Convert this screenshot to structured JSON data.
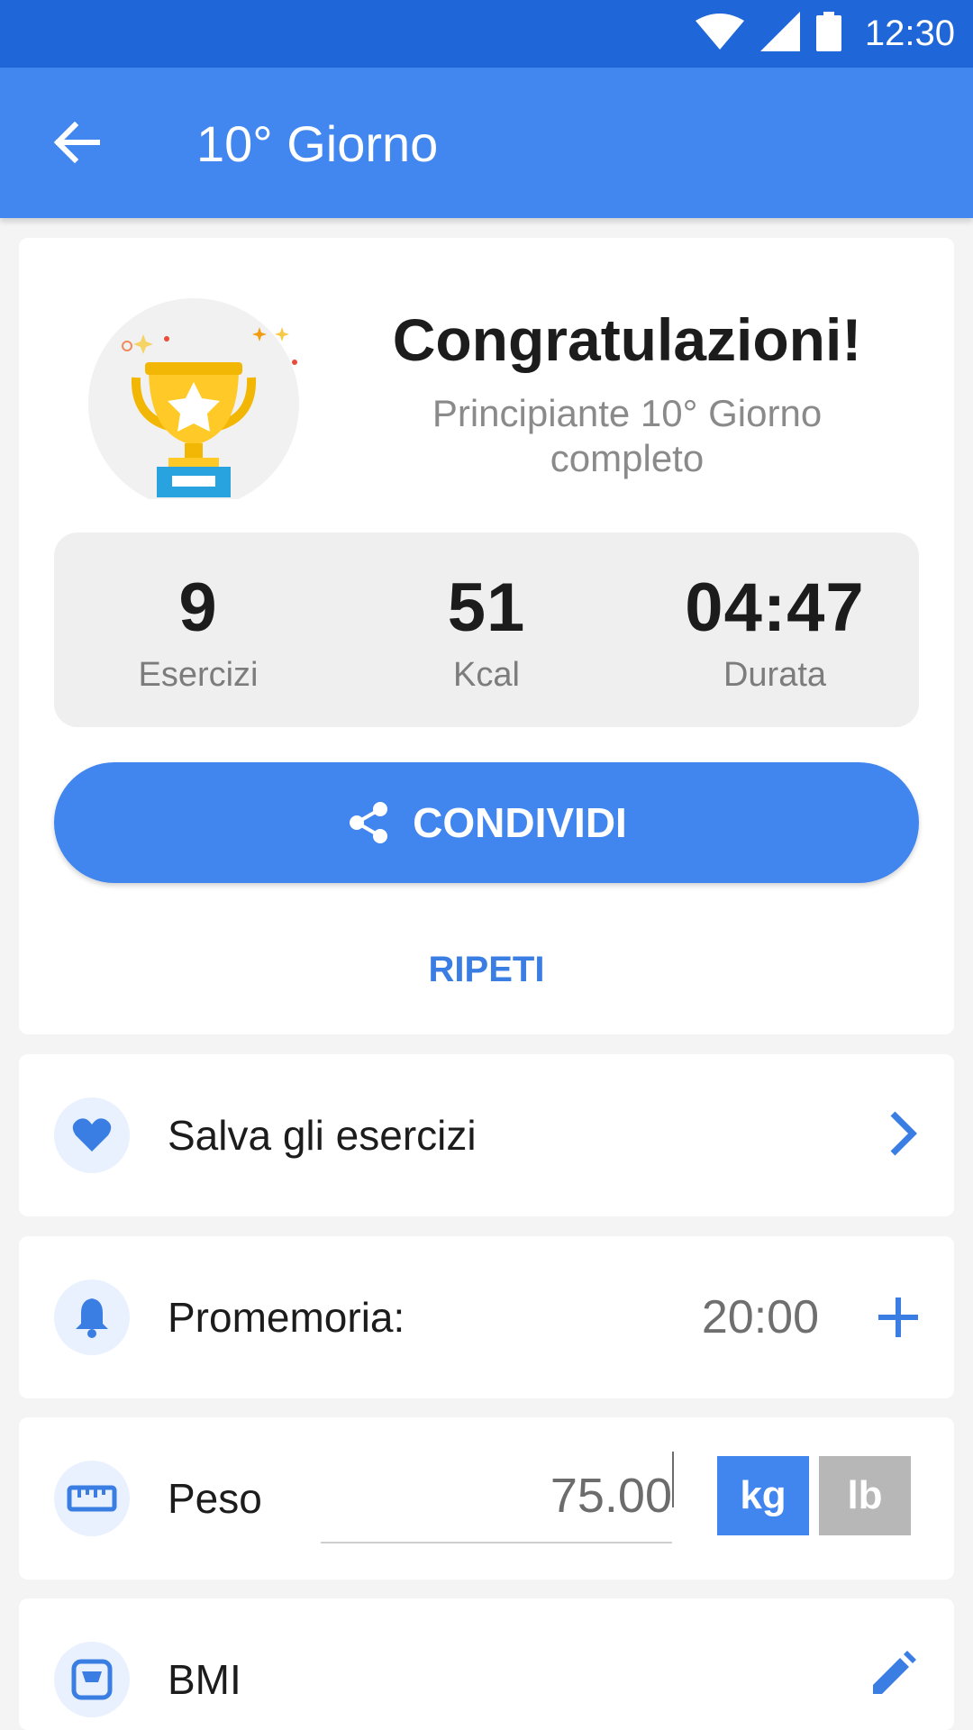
{
  "status_bar": {
    "time": "12:30"
  },
  "app_bar": {
    "title": "10° Giorno"
  },
  "result": {
    "heading": "Congratulazioni!",
    "subtitle": "Principiante 10° Giorno completo"
  },
  "stats": [
    {
      "value": "9",
      "label": "Esercizi"
    },
    {
      "value": "51",
      "label": "Kcal"
    },
    {
      "value": "04:47",
      "label": "Durata"
    }
  ],
  "share_label": "CONDIVIDI",
  "repeat_label": "RIPETI",
  "save": {
    "label": "Salva gli esercizi"
  },
  "reminder": {
    "label": "Promemoria:",
    "time": "20:00"
  },
  "weight": {
    "label": "Peso",
    "value": "75.00",
    "unit_kg": "kg",
    "unit_lb": "lb",
    "selected_unit": "kg"
  },
  "bmi": {
    "label": "BMI"
  },
  "colors": {
    "primary": "#4287f0",
    "status_bar": "#1f66d8",
    "accent_text": "#3b7ee3",
    "inactive_unit": "#b7b7b7"
  }
}
